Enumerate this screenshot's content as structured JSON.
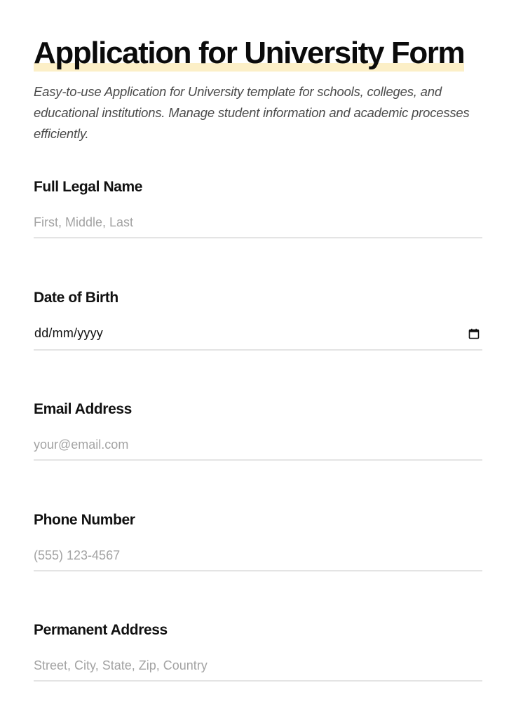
{
  "form": {
    "title": "Application for University Form",
    "subtitle": "Easy-to-use Application for University template for schools, colleges, and educational institutions. Manage student information and academic processes efficiently."
  },
  "fields": {
    "full_name": {
      "label": "Full Legal Name",
      "placeholder": "First, Middle, Last"
    },
    "date_of_birth": {
      "label": "Date of Birth",
      "value": "dd/mm/yyyy",
      "icon": "calendar-icon"
    },
    "email": {
      "label": "Email Address",
      "placeholder": "your@email.com"
    },
    "phone": {
      "label": "Phone Number",
      "placeholder": "(555) 123-4567"
    },
    "address": {
      "label": "Permanent Address",
      "placeholder": "Street, City, State, Zip, Country"
    }
  },
  "colors": {
    "title_highlight": "#fcefc7",
    "placeholder": "#a3a3a3",
    "underline": "#e4e4e4"
  }
}
